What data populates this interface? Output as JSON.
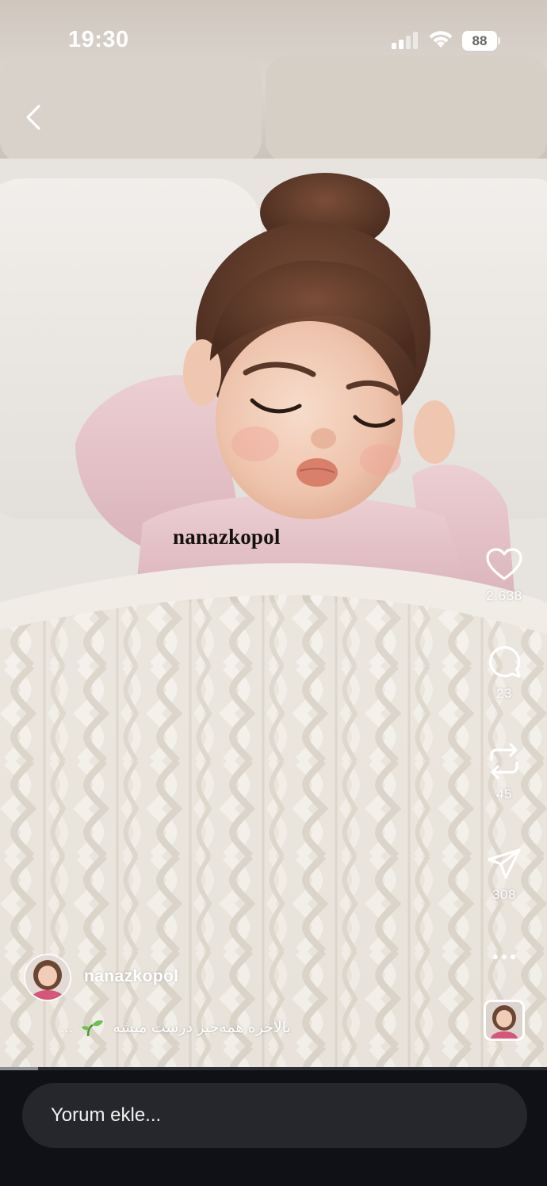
{
  "status_bar": {
    "time": "19:30",
    "battery_level": "88",
    "signal-icon": "cellular-signal-icon",
    "wifi-icon": "wifi-icon"
  },
  "post": {
    "watermark": "nanazkopol",
    "author": "nanazkopol",
    "caption_text": "بالاخره همه‌چیز درست میشه",
    "caption_more": "...",
    "progress": 0.07
  },
  "actions": {
    "likes": "2.638",
    "comments": "23",
    "reposts": "45",
    "shares": "308"
  },
  "comment_box": {
    "placeholder": "Yorum ekle..."
  },
  "colors": {
    "bottom_bar": "#0f1116",
    "input_bg": "#25272c",
    "icon": "#ffffff"
  }
}
